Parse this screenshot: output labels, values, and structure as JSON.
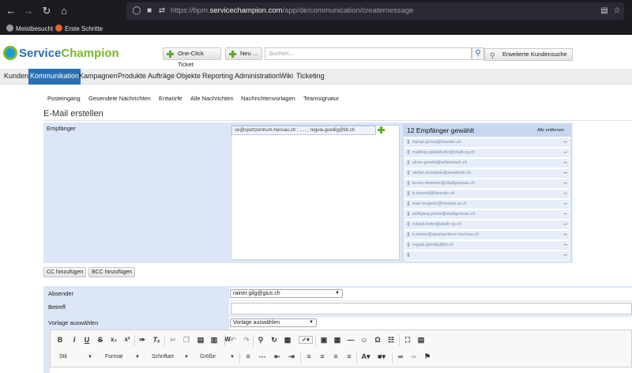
{
  "browser": {
    "url_prefix": "https://bpm.",
    "url_host": "servicechampion.com",
    "url_path": "/app/de/communication/createmessage",
    "bookmarks": [
      "Meistbesucht",
      "Erste Schritte"
    ]
  },
  "header": {
    "logo_part1": "Service",
    "logo_part2": "Champion",
    "one_click_ticket": "One-Click Ticket",
    "new_label": "Neu ...",
    "search_placeholder": "Suchen...",
    "extended_search": "Erweiterte Kundensuche"
  },
  "menu": {
    "items": [
      "Kunden",
      "Kommunikation",
      "Kampagnen",
      "Produkte",
      "Aufträge",
      "Objekte",
      "Reporting",
      "Administration",
      "Wiki",
      "Ticketing"
    ],
    "active": "Kommunikation"
  },
  "subnav": [
    "Posteingang",
    "Gesendete Nachrichten",
    "Entwürfe",
    "Alle Nachrichten",
    "Nachrichtenvorlagen",
    "Teamsignatur"
  ],
  "page_title": "E-Mail erstellen",
  "recipients": {
    "label": "Empfänger",
    "chip_text": "se@sportzentrum-herisau.ch ; ..... ; regula.goedig@kb.ch",
    "selected_title": "12 Empfänger gewählt",
    "remove_all": "Alle entfernen",
    "list": [
      "hampi.gross@bluewin.ch",
      "mathias.gabathuler@stadt-sg.ch",
      "oliver.groebli@willenbach.ch",
      "stefan.strasbole@strasbole.ch",
      "bruno.wessner@stadtgossau.ch",
      "b.brovelli@bluewin.ch",
      "max.mugster@herisau.ar.ch",
      "wolfgang.piehe@stadtgossau.ch",
      "roland.hofer@stadt-sg.ch",
      "k.weber@sportzentrum-herisau.ch",
      "regula.goedig@kb.ch",
      ""
    ]
  },
  "buttons": {
    "cc": "CC hinzufügen",
    "bcc": "BCC hinzufügen"
  },
  "form": {
    "sender_label": "Absender",
    "sender_value": "rainer.gilg@gius.ch",
    "subject_label": "Betreff",
    "template_label": "Vorlage auswählen",
    "template_value": "Vorlage auswählen"
  },
  "editor": {
    "style_combo": "Stil",
    "format_combo": "Format",
    "font_combo": "Schriftart",
    "size_combo": "Größe"
  }
}
